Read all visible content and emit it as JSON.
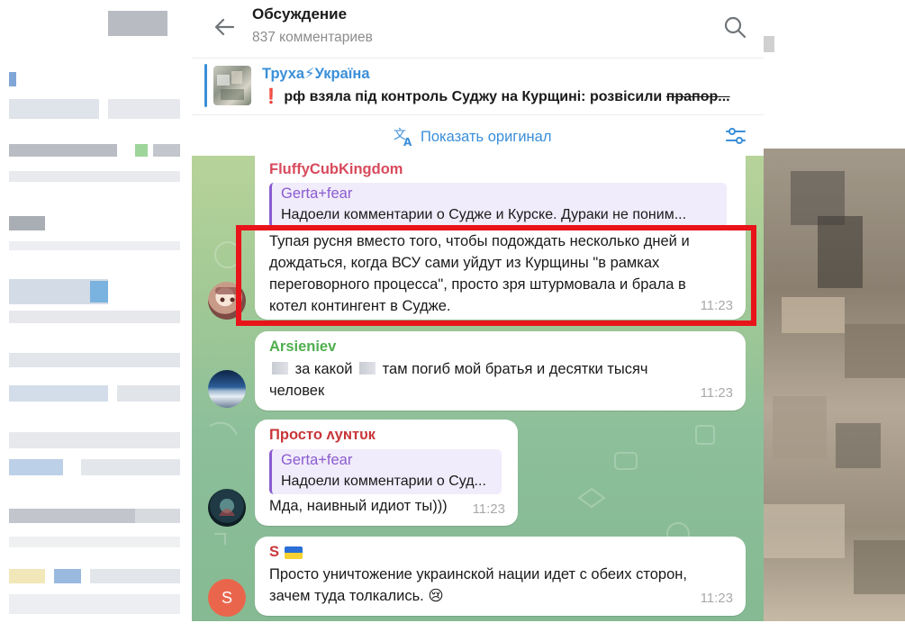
{
  "header": {
    "title": "Обсуждение",
    "subtitle": "837 комментариев"
  },
  "pinned": {
    "channel_name": "Труха⚡Україна",
    "text_main": "рф взяла під контроль Суджу на Курщині: розвісили ",
    "text_strike": "прапор..."
  },
  "translate": {
    "show_original_label": "Показать оригинал"
  },
  "messages": [
    {
      "sender": "FluffyCubKingdom",
      "sender_color": "#d84a5c",
      "reply_name": "Gerta+fear",
      "reply_text": "Надоели комментарии о Судже и Курске. Дураки не поним...",
      "lines": [
        "Тупая русня вместо того, чтобы подождать несколько дней и",
        "дождаться, когда ВСУ сами уйдут из Курщины \"в рамках",
        "переговорного процесса\", просто зря штурмовала и брала в",
        "котел контингент в Судже."
      ],
      "time": "11:23"
    },
    {
      "sender": "Arsieniev",
      "sender_color": "#4fae4e",
      "line1_a": "за какой",
      "line1_b": "там погиб мой братья и десятки тысяч",
      "line2": "человек",
      "time": "11:23"
    },
    {
      "sender": "Просто ʌуɴтυк",
      "sender_color": "#d84a3a",
      "reply_name": "Gerta+fear",
      "reply_text": "Надоели комментарии о Суд...",
      "text": "Мда, наивный идиот ты)))",
      "time": "11:23"
    },
    {
      "sender": "S",
      "sender_color": "#d84a3a",
      "avatar_letter": "S",
      "lines": [
        "Просто уничтожение украинской нации идет с обеих сторон,",
        "зачем туда толкались. 😢"
      ],
      "time": "11:23"
    }
  ],
  "colors": {
    "accent": "#3a8fd9",
    "highlight": "#e8141a"
  }
}
